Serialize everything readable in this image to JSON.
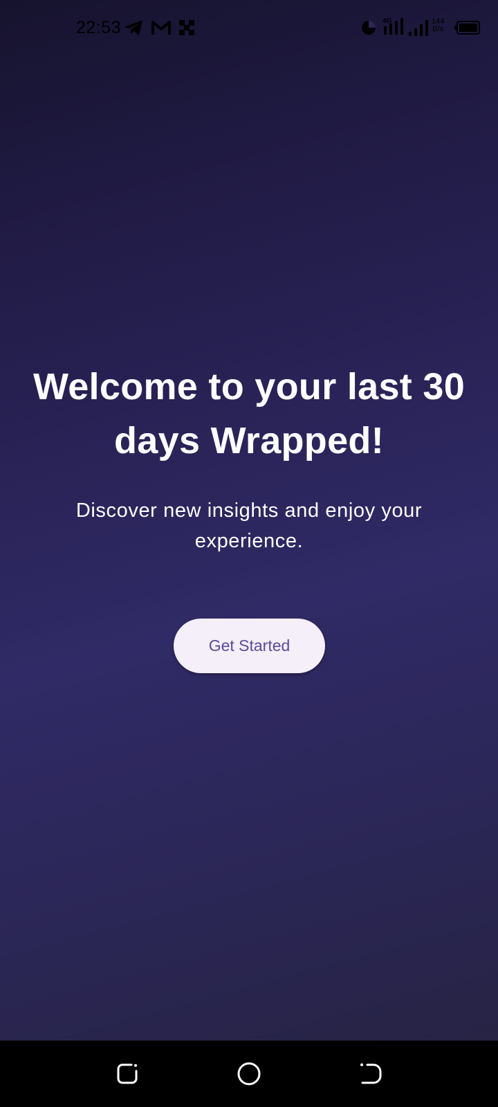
{
  "status_bar": {
    "time": "22:53",
    "net_speed_value": "144",
    "net_speed_unit": "B/s",
    "network_type": "4G",
    "notification_icons": [
      "telegram-icon",
      "gmail-icon",
      "app-grid-icon"
    ],
    "system_icons": [
      "data-saver-icon",
      "signal-icon",
      "signal-icon",
      "battery-icon"
    ]
  },
  "main": {
    "title": "Welcome to your last 30 days Wrapped!",
    "subtitle": "Discover new insights and enjoy your experience.",
    "cta_label": "Get Started"
  },
  "nav_bar": {
    "buttons": [
      "recents-icon",
      "home-icon",
      "back-icon"
    ]
  },
  "colors": {
    "background_top": "#16132e",
    "background_mid": "#302a66",
    "background_bottom": "#25223f",
    "button_bg": "#f4eff8",
    "button_text": "#5b4a99",
    "text": "#ffffff"
  }
}
